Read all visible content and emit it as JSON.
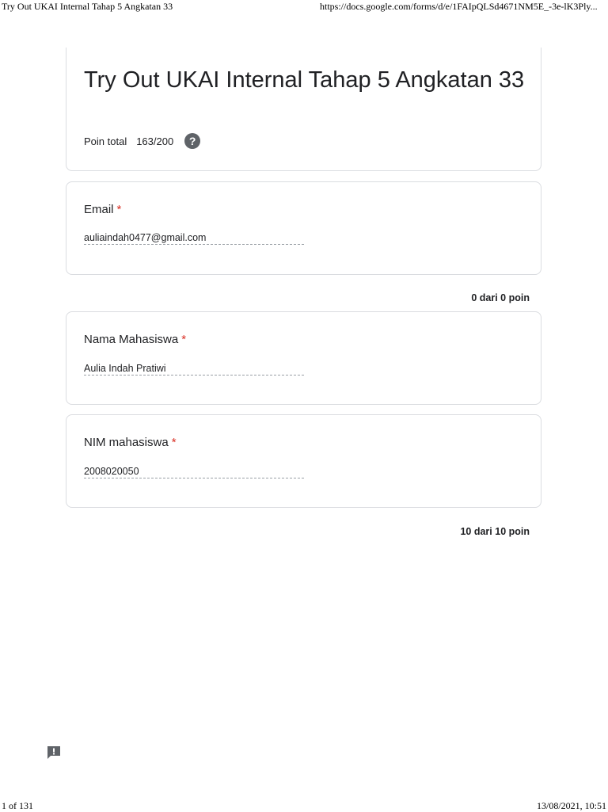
{
  "print_header": {
    "title": "Try Out UKAI Internal Tahap 5 Angkatan 33",
    "url": "https://docs.google.com/forms/d/e/1FAIpQLSd4671NM5E_-3e-lK3Ply..."
  },
  "print_footer": {
    "page": "1 of 131",
    "datetime": "13/08/2021, 10:51"
  },
  "form": {
    "title": "Try Out UKAI Internal Tahap 5 Angkatan 33",
    "score_label": "Poin total",
    "score_value": "163/200"
  },
  "questions": [
    {
      "label": "Email",
      "required_mark": "*",
      "answer": "auliaindah0477@gmail.com"
    },
    {
      "label": "Nama Mahasiswa",
      "required_mark": "*",
      "answer": "Aulia Indah Pratiwi"
    },
    {
      "label": "NIM mahasiswa",
      "required_mark": "*",
      "answer": "2008020050"
    }
  ],
  "section_points": [
    "0 dari 0 poin",
    "10 dari 10 poin"
  ],
  "icons": {
    "help": "help-circle-icon",
    "feedback": "feedback-icon"
  },
  "colors": {
    "required": "#d93025",
    "border": "#dadce0",
    "icon": "#5f6368"
  }
}
